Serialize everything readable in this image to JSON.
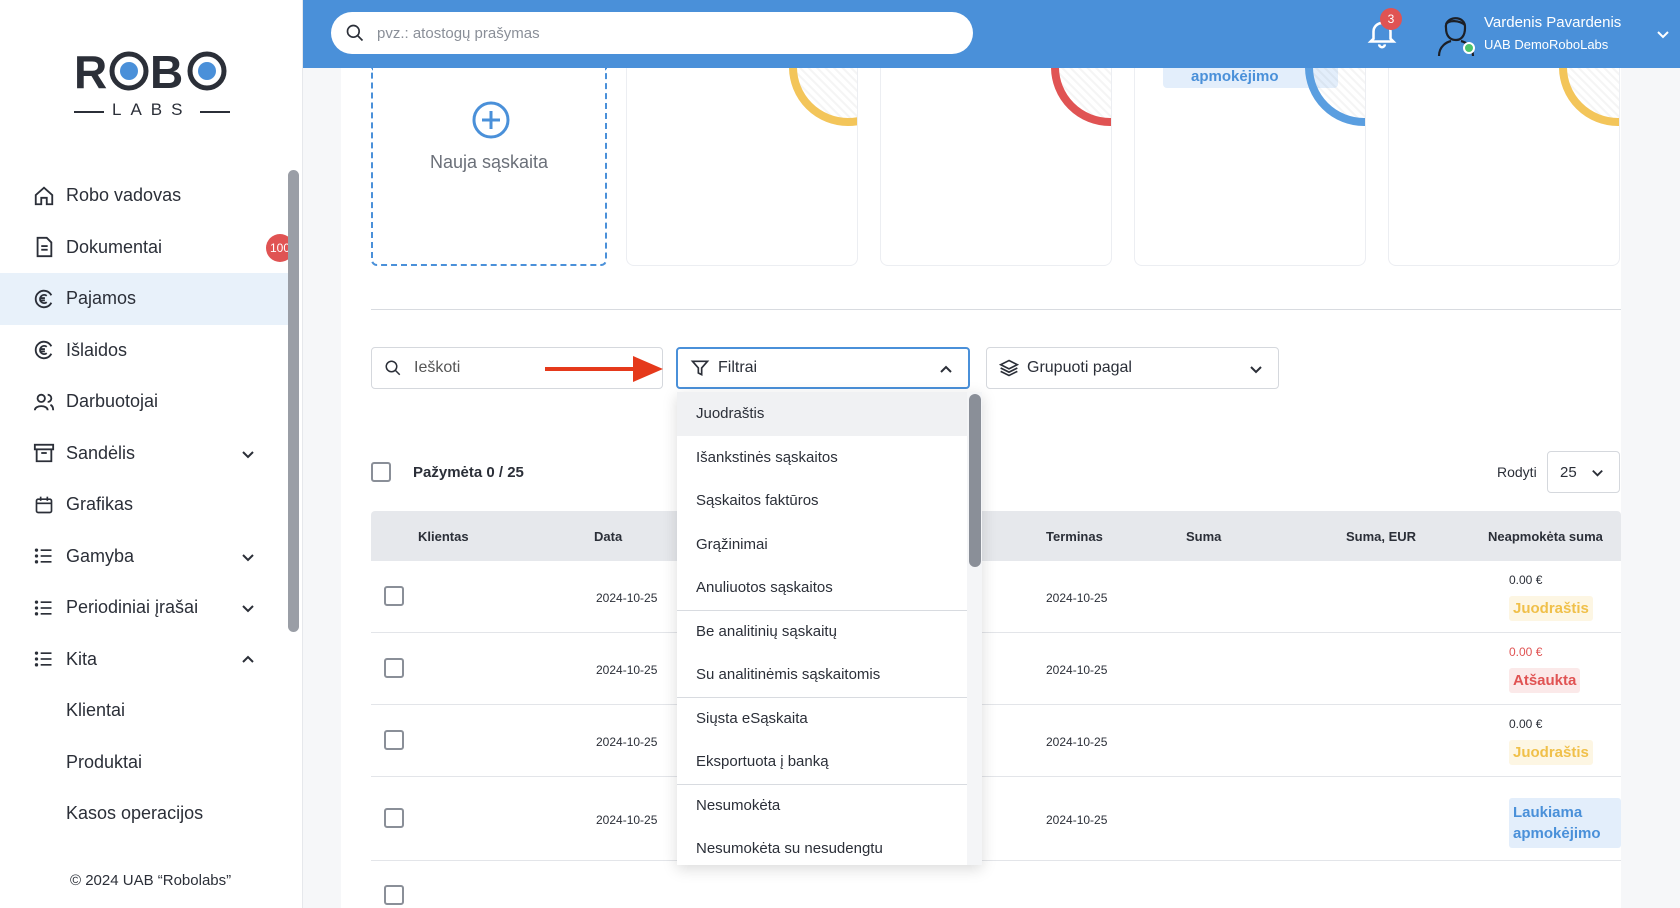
{
  "brand": {
    "logo_top": "ROBO",
    "logo_bottom": "LABS",
    "copyright": "© 2024 UAB “Robolabs”"
  },
  "sidebar": {
    "items": [
      {
        "label": "Robo vadovas",
        "icon": "home-icon"
      },
      {
        "label": "Dokumentai",
        "icon": "document-icon",
        "badge": "100"
      },
      {
        "label": "Pajamos",
        "icon": "euro-circle-icon",
        "active": true
      },
      {
        "label": "Išlaidos",
        "icon": "euro-circle-icon"
      },
      {
        "label": "Darbuotojai",
        "icon": "users-icon"
      },
      {
        "label": "Sandėlis",
        "icon": "archive-icon",
        "chevron": "down"
      },
      {
        "label": "Grafikas",
        "icon": "calendar-icon"
      },
      {
        "label": "Gamyba",
        "icon": "list-icon",
        "chevron": "down"
      },
      {
        "label": "Periodiniai įrašai",
        "icon": "list-icon",
        "chevron": "down"
      },
      {
        "label": "Kita",
        "icon": "list-icon",
        "chevron": "up"
      }
    ],
    "subitems": [
      "Klientai",
      "Produktai",
      "Kasos operacijos"
    ]
  },
  "topbar": {
    "search_placeholder": "pvz.: atostogų prašymas",
    "notifications_count": "3",
    "user_name": "Vardenis Pavardenis",
    "user_company": "UAB DemoRoboLabs"
  },
  "cards": {
    "new_invoice_label": "Nauja sąskaita",
    "chip_label": "apmokėjimo"
  },
  "toolbar": {
    "search_placeholder": "Ieškoti",
    "filters_label": "Filtrai",
    "group_by_label": "Grupuoti pagal"
  },
  "selection": {
    "label": "Pažymėta 0 / 25",
    "show_label": "Rodyti",
    "page_size": "25"
  },
  "table": {
    "headers": [
      "Klientas",
      "Data",
      "Terminas",
      "Suma",
      "Suma, EUR",
      "Neapmokėta suma"
    ],
    "rows": [
      {
        "date": "2024-10-25",
        "term": "2024-10-25",
        "unpaid": "0.00 €",
        "status": "Juodraštis",
        "kind": "draft"
      },
      {
        "date": "2024-10-25",
        "term": "2024-10-25",
        "unpaid": "0.00 €",
        "status": "Atšaukta",
        "kind": "cancel"
      },
      {
        "date": "2024-10-25",
        "term": "2024-10-25",
        "unpaid": "0.00 €",
        "status": "Juodraštis",
        "kind": "draft"
      },
      {
        "date": "2024-10-25",
        "term": "2024-10-25",
        "unpaid": "",
        "status": "Laukiama apmokėjimo",
        "kind": "wait"
      }
    ]
  },
  "filters_dropdown": {
    "options": [
      "Juodraštis",
      "Išankstinės sąskaitos",
      "Sąskaitos faktūros",
      "Grąžinimai",
      "Anuliuotos sąskaitos",
      "Be analitinių sąskaitų",
      "Su analitinėmis sąskaitomis",
      "Siųsta eSąskaita",
      "Eksportuota į banką",
      "Nesumokėta",
      "Nesumokėta su nesudengtu"
    ]
  },
  "colors": {
    "accent": "#4a90d9",
    "danger": "#e05353",
    "warning": "#f0c04a",
    "success": "#4cc36b"
  }
}
